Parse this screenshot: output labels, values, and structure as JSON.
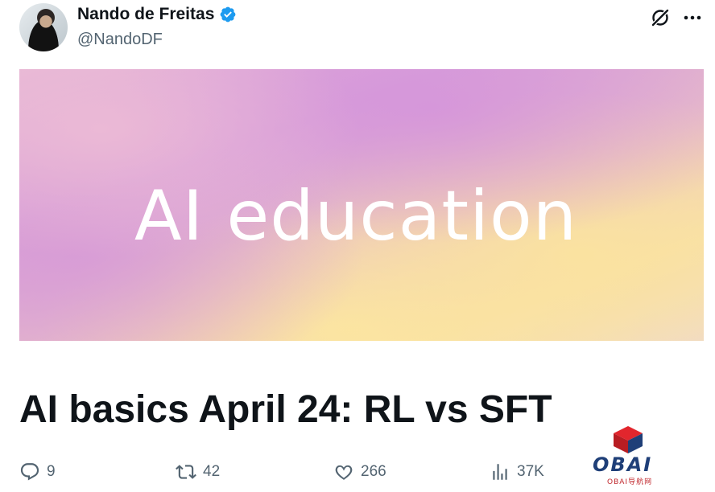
{
  "author": {
    "display_name": "Nando de Freitas",
    "handle": "@NandoDF",
    "verified": true
  },
  "header_icons": [
    "grok-icon",
    "more-icon"
  ],
  "media": {
    "banner_text": "AI education"
  },
  "post": {
    "title": "AI basics April 24: RL vs SFT"
  },
  "actions": {
    "replies": "9",
    "reposts": "42",
    "likes": "266",
    "views": "37K"
  },
  "watermark": {
    "brand": "OBAI",
    "sub": "OBAI导航网"
  },
  "colors": {
    "text_primary": "#0f1419",
    "text_secondary": "#536471",
    "verified_blue": "#1d9bf0",
    "watermark_blue": "#1f3f78",
    "watermark_red": "#c0282d"
  }
}
